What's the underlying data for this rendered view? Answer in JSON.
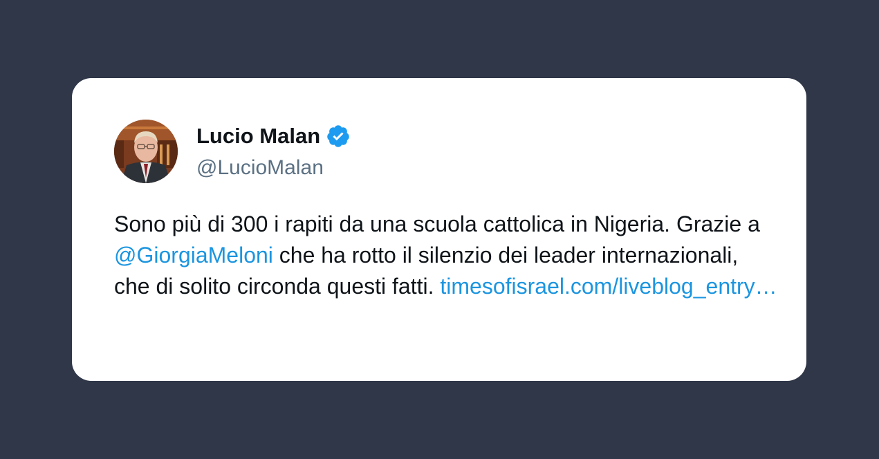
{
  "author": {
    "name": "Lucio Malan",
    "handle": "@LucioMalan",
    "verified_icon": "verified-badge-icon",
    "avatar_alt": "avatar"
  },
  "tweet": {
    "text_part1": "Sono più di 300 i rapiti da una scuola cattolica in Nigeria. Grazie a ",
    "mention": "@GiorgiaMeloni",
    "text_part2": " che ha rotto il silenzio dei leader internazionali, che di solito circonda questi fatti. ",
    "link": "timesofisrael.com/liveblog_entry…"
  },
  "colors": {
    "background": "#2f3748",
    "card": "#ffffff",
    "text": "#0f1419",
    "handle": "#5b7083",
    "link": "#1b95e0",
    "verified": "#1d9bf0"
  }
}
